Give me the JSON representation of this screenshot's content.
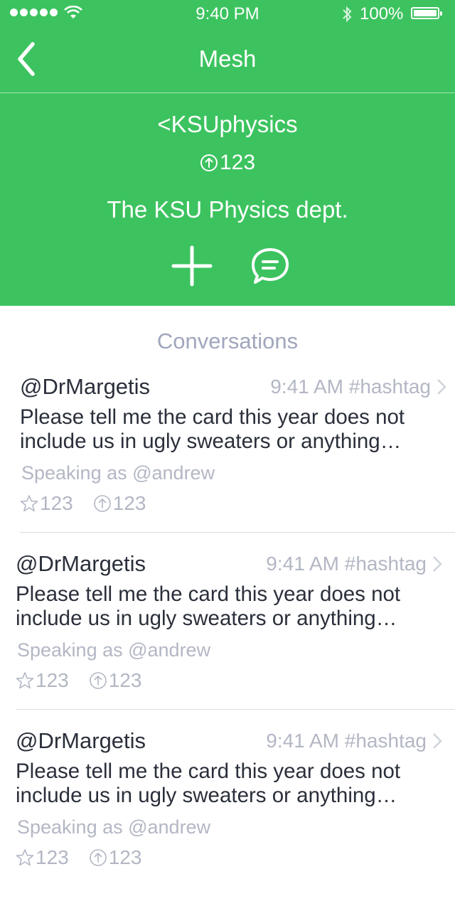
{
  "status_bar": {
    "time": "9:40 PM",
    "battery": "100%"
  },
  "nav": {
    "title": "Mesh",
    "back_icon": "chevron-left-icon"
  },
  "group": {
    "handle": "<KSUphysics",
    "upvotes": "123",
    "description": "The KSU Physics dept.",
    "add_icon": "plus-icon",
    "chat_icon": "chat-bubble-icon"
  },
  "conversations": {
    "title": "Conversations",
    "items": [
      {
        "author": "@DrMargetis",
        "meta": "9:41 AM #hashtag",
        "body": "Please tell me the card this year does not include us in ugly sweaters or anything…",
        "speaking": "Speaking as @andrew",
        "stars": "123",
        "upvotes": "123"
      },
      {
        "author": "@DrMargetis",
        "meta": "9:41 AM #hashtag",
        "body": "Please tell me the card this year does not include us in ugly sweaters or anything…",
        "speaking": "Speaking as @andrew",
        "stars": "123",
        "upvotes": "123"
      },
      {
        "author": "@DrMargetis",
        "meta": "9:41 AM #hashtag",
        "body": "Please tell me the card this year does not include us in ugly sweaters or anything…",
        "speaking": "Speaking as @andrew",
        "stars": "123",
        "upvotes": "123"
      }
    ]
  },
  "colors": {
    "brand_green": "#3cc35f",
    "muted_text": "#b3b7c4",
    "section_title": "#a0a6bd"
  }
}
